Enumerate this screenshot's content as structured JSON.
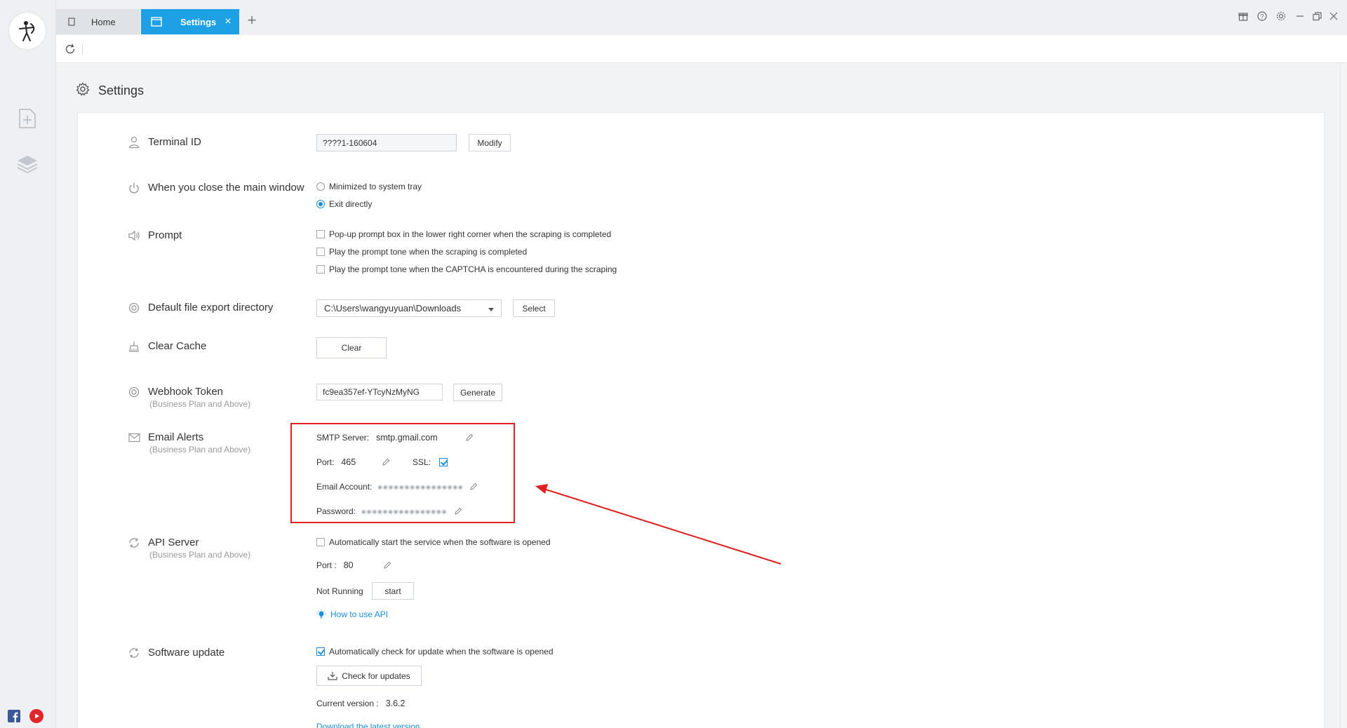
{
  "tabs": [
    {
      "label": "Home",
      "active": false
    },
    {
      "label": "Settings",
      "active": true
    }
  ],
  "page": {
    "title": "Settings"
  },
  "terminal": {
    "label": "Terminal ID",
    "value": "????1-160604",
    "button": "Modify"
  },
  "close_window": {
    "label": "When you close the main window",
    "options": [
      {
        "label": "Minimized to system tray",
        "selected": false
      },
      {
        "label": "Exit directly",
        "selected": true
      }
    ]
  },
  "prompt": {
    "label": "Prompt",
    "options": [
      {
        "label": "Pop-up prompt box in the lower right corner when the scraping is completed",
        "checked": false
      },
      {
        "label": "Play the prompt tone when the scraping is completed",
        "checked": false
      },
      {
        "label": "Play the prompt tone when the CAPTCHA is encountered during the scraping",
        "checked": false
      }
    ]
  },
  "export_dir": {
    "label": "Default file export directory",
    "value": "C:\\Users\\wangyuyuan\\Downloads",
    "button": "Select"
  },
  "cache": {
    "label": "Clear Cache",
    "button": "Clear"
  },
  "webhook": {
    "label": "Webhook Token",
    "sublabel": "(Business Plan and Above)",
    "value": "fc9ea357ef-YTcyNzMyNG",
    "button": "Generate"
  },
  "email": {
    "label": "Email Alerts",
    "sublabel": "(Business Plan and Above)",
    "smtp_label": "SMTP Server:",
    "smtp_value": "smtp.gmail.com",
    "port_label": "Port:",
    "port_value": "465",
    "ssl_label": "SSL:",
    "ssl_checked": true,
    "account_label": "Email Account:",
    "password_label": "Password:"
  },
  "api": {
    "label": "API Server",
    "sublabel": "(Business Plan and Above)",
    "auto_start": "Automatically start the service when the software is opened",
    "auto_start_checked": false,
    "port_label": "Port :",
    "port_value": "80",
    "status": "Not Running",
    "start_button": "start",
    "howto": "How to use API"
  },
  "update": {
    "label": "Software update",
    "auto_check": "Automatically check for update when the software is opened",
    "auto_check_checked": true,
    "check_button": "Check for updates",
    "current_version_label": "Current version :",
    "current_version": "3.6.2",
    "download_link": "Download the latest version"
  },
  "colors": {
    "accent": "#1ea0e4",
    "highlight": "#e02020"
  }
}
